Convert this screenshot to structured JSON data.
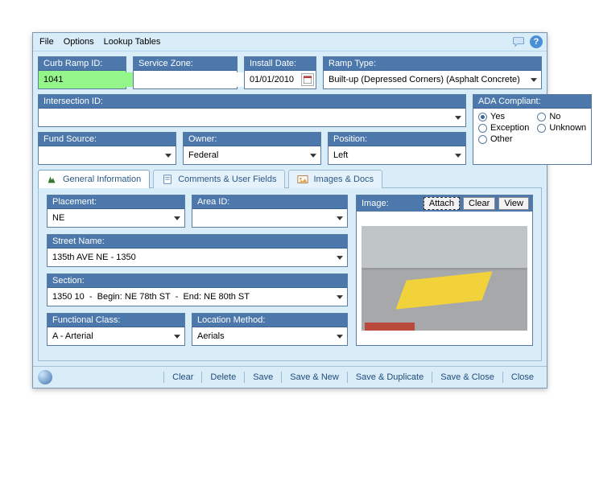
{
  "menu": {
    "file": "File",
    "options": "Options",
    "lookup": "Lookup Tables"
  },
  "top": {
    "curb_ramp_id": {
      "label": "Curb Ramp ID:",
      "value": "1041"
    },
    "service_zone": {
      "label": "Service Zone:",
      "value": ""
    },
    "install_date": {
      "label": "Install Date:",
      "value": "01/01/2010"
    },
    "ramp_type": {
      "label": "Ramp Type:",
      "value": "Built-up (Depressed Corners) (Asphalt Concrete)"
    },
    "intersection_id": {
      "label": "Intersection ID:",
      "value": ""
    },
    "fund_source": {
      "label": "Fund Source:",
      "value": ""
    },
    "owner": {
      "label": "Owner:",
      "value": "Federal"
    },
    "position": {
      "label": "Position:",
      "value": "Left"
    }
  },
  "ada": {
    "label": "ADA Compliant:",
    "options": {
      "yes": "Yes",
      "no": "No",
      "exception": "Exception",
      "unknown": "Unknown",
      "other": "Other"
    },
    "selected": "yes"
  },
  "tabs": {
    "general": "General Information",
    "comments": "Comments & User Fields",
    "images": "Images & Docs"
  },
  "general": {
    "placement": {
      "label": "Placement:",
      "value": "NE"
    },
    "area_id": {
      "label": "Area ID:",
      "value": ""
    },
    "street_name": {
      "label": "Street Name:",
      "value": "135th AVE NE - 1350"
    },
    "section": {
      "label": "Section:",
      "value": "1350 10  -  Begin: NE 78th ST  -  End: NE 80th ST"
    },
    "functional_class": {
      "label": "Functional Class:",
      "value": "A - Arterial"
    },
    "location_method": {
      "label": "Location Method:",
      "value": "Aerials"
    }
  },
  "image": {
    "label": "Image:",
    "attach": "Attach",
    "clear": "Clear",
    "view": "View"
  },
  "footer": {
    "clear": "Clear",
    "delete": "Delete",
    "save": "Save",
    "save_new": "Save & New",
    "save_dup": "Save & Duplicate",
    "save_close": "Save & Close",
    "close": "Close"
  }
}
